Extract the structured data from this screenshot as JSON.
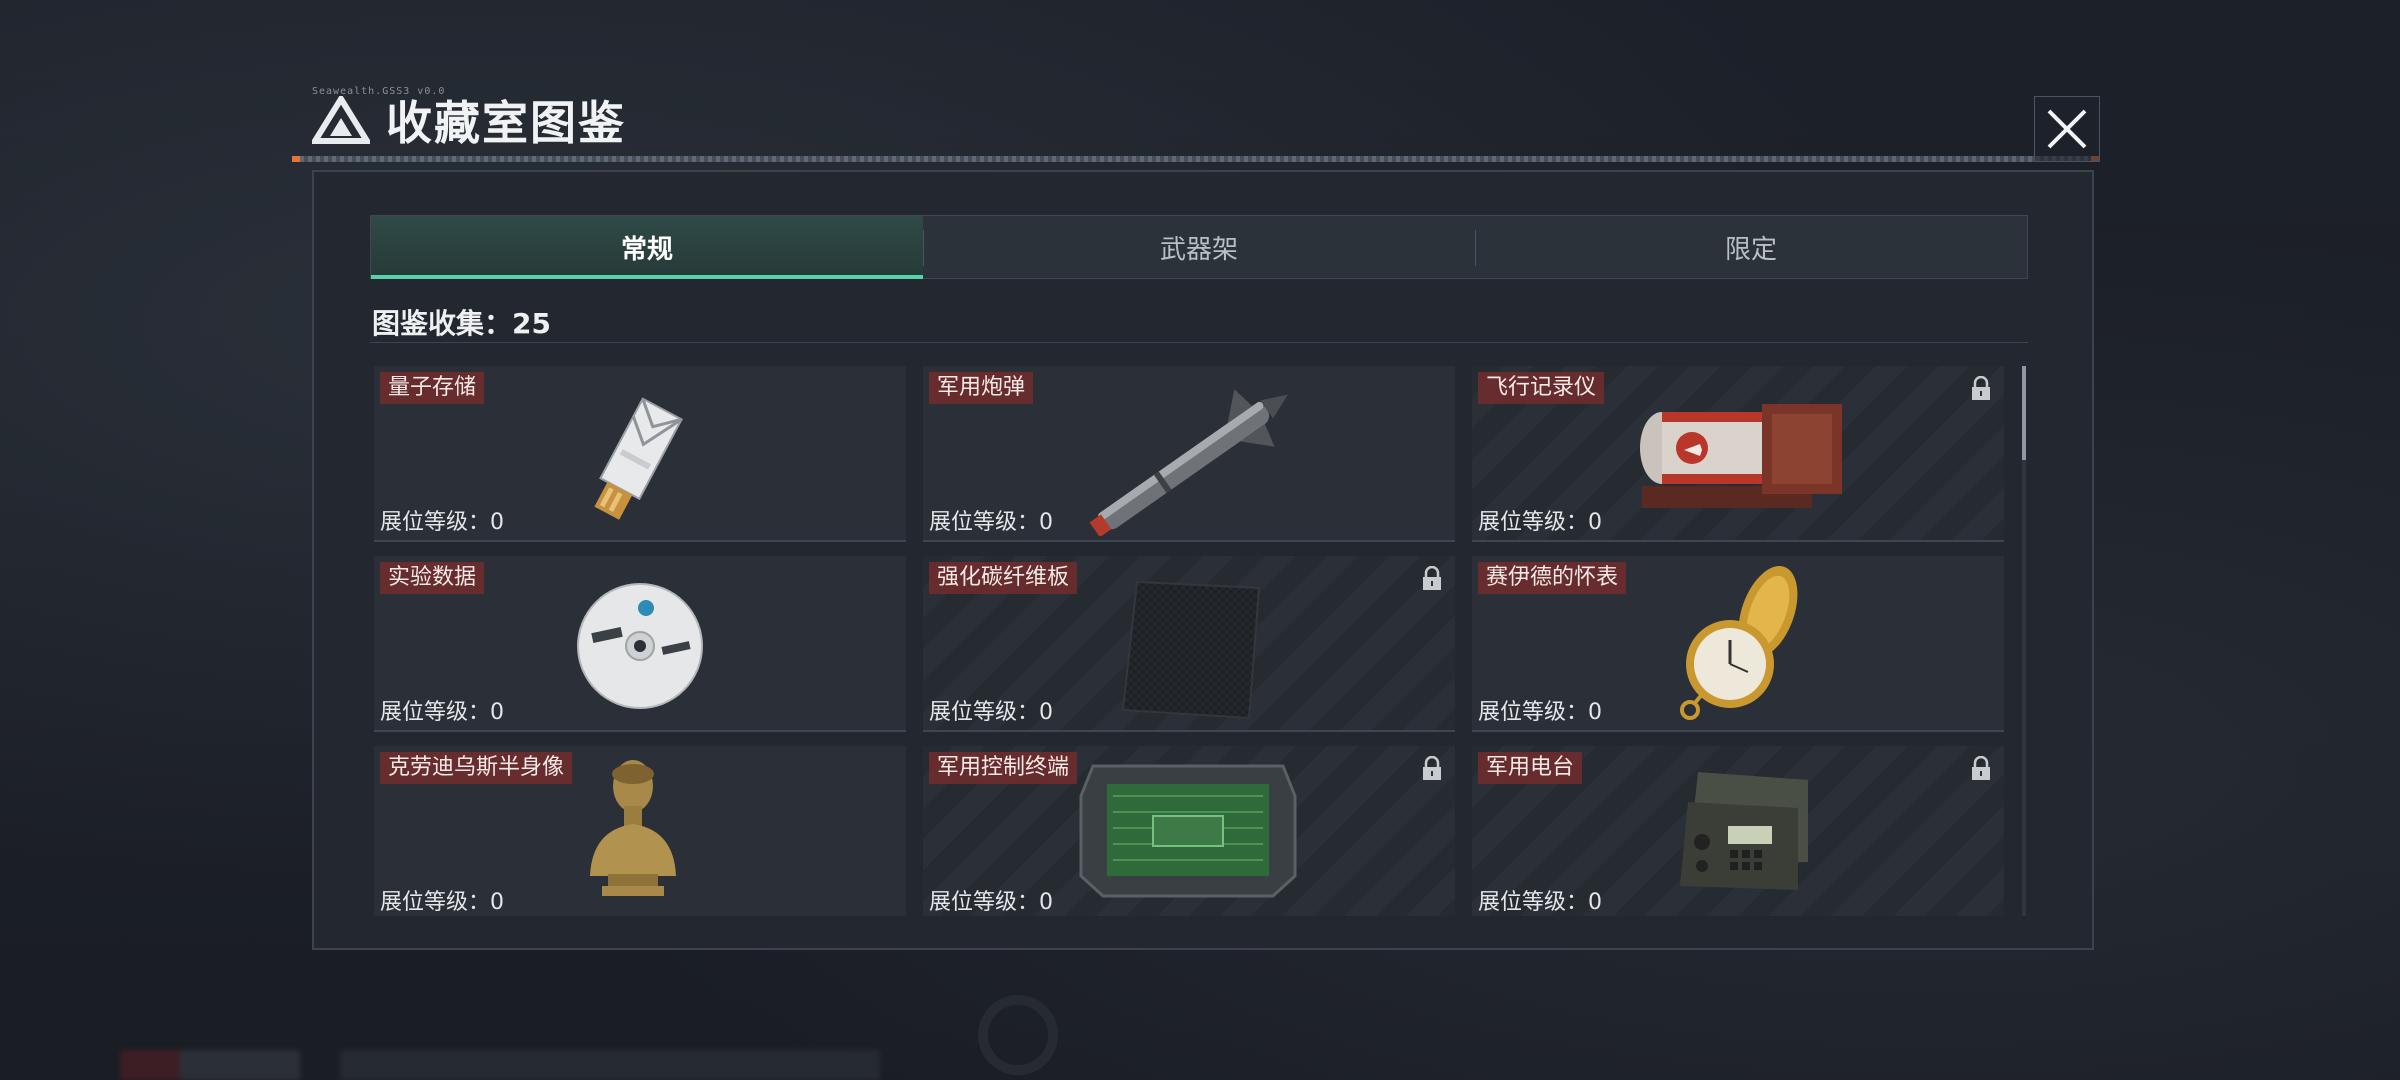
{
  "header": {
    "title": "收藏室图鉴",
    "subtitle": "Seawealth.GSS3 v0.0"
  },
  "tabs": [
    {
      "label": "常规",
      "active": true
    },
    {
      "label": "武器架",
      "active": false
    },
    {
      "label": "限定",
      "active": false
    }
  ],
  "collection": {
    "count_text": "图鉴收集：25"
  },
  "items": [
    {
      "name": "量子存储",
      "level": "展位等级：0",
      "locked": false,
      "icon": "usb-drive-icon"
    },
    {
      "name": "军用炮弹",
      "level": "展位等级：0",
      "locked": false,
      "icon": "missile-shell-icon"
    },
    {
      "name": "飞行记录仪",
      "level": "展位等级：0",
      "locked": true,
      "icon": "flight-recorder-icon"
    },
    {
      "name": "实验数据",
      "level": "展位等级：0",
      "locked": false,
      "icon": "data-disc-icon"
    },
    {
      "name": "强化碳纤维板",
      "level": "展位等级：0",
      "locked": true,
      "icon": "carbon-plate-icon"
    },
    {
      "name": "赛伊德的怀表",
      "level": "展位等级：0",
      "locked": false,
      "icon": "pocket-watch-icon"
    },
    {
      "name": "克劳迪乌斯半身像",
      "level": "展位等级：0",
      "locked": false,
      "icon": "bust-statue-icon"
    },
    {
      "name": "军用控制终端",
      "level": "展位等级：0",
      "locked": true,
      "icon": "control-terminal-icon"
    },
    {
      "name": "军用电台",
      "level": "展位等级：0",
      "locked": true,
      "icon": "radio-icon"
    }
  ],
  "colors": {
    "accent": "#58d3a8",
    "name_tag": "#782c2c",
    "close_accent": "#e5733a"
  }
}
